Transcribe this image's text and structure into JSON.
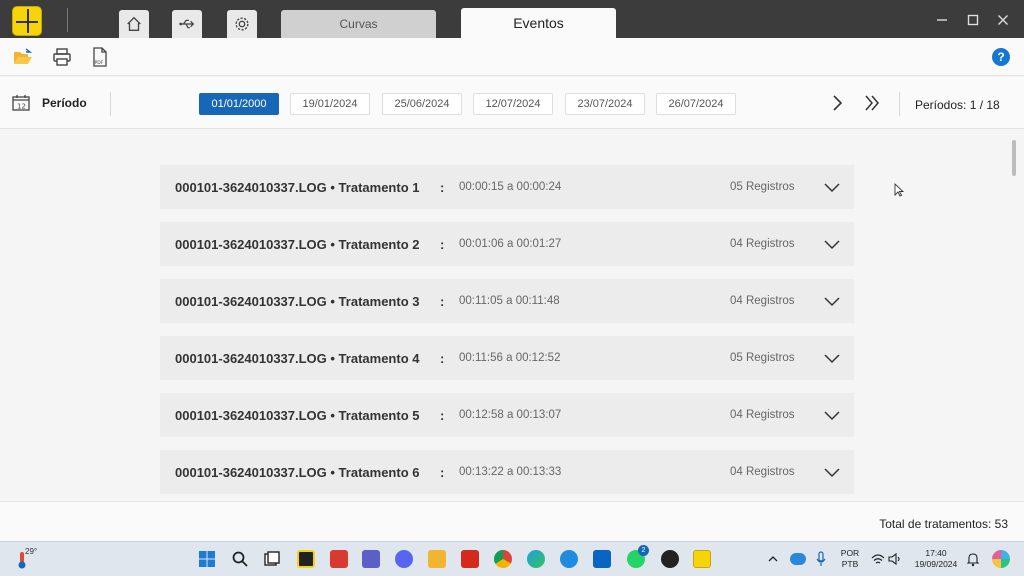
{
  "titlebar": {
    "tabs": [
      {
        "label": "Curvas"
      },
      {
        "label": "Eventos"
      }
    ]
  },
  "period": {
    "label": "Período",
    "dates": [
      "01/01/2000",
      "19/01/2024",
      "25/06/2024",
      "12/07/2024",
      "23/07/2024",
      "26/07/2024"
    ],
    "active_index": 0,
    "count_text": "Períodos: 1 / 18"
  },
  "events": [
    {
      "name": "000101-3624010337.LOG • Tratamento 1",
      "sep": ":",
      "time": "00:00:15 a 00:00:24",
      "count": "05 Registros"
    },
    {
      "name": "000101-3624010337.LOG • Tratamento 2",
      "sep": ":",
      "time": "00:01:06 a 00:01:27",
      "count": "04 Registros"
    },
    {
      "name": "000101-3624010337.LOG • Tratamento 3",
      "sep": ":",
      "time": "00:11:05 a 00:11:48",
      "count": "04 Registros"
    },
    {
      "name": "000101-3624010337.LOG • Tratamento 4",
      "sep": ":",
      "time": "00:11:56 a 00:12:52",
      "count": "05 Registros"
    },
    {
      "name": "000101-3624010337.LOG • Tratamento 5",
      "sep": ":",
      "time": "00:12:58 a 00:13:07",
      "count": "04 Registros"
    },
    {
      "name": "000101-3624010337.LOG • Tratamento 6",
      "sep": ":",
      "time": "00:13:22 a 00:13:33",
      "count": "04 Registros"
    }
  ],
  "footer": {
    "total": "Total de tratamentos: 53"
  },
  "taskbar": {
    "weather_temp": "29°",
    "lang_1": "POR",
    "lang_2": "PTB",
    "time": "17:40",
    "date": "19/09/2024",
    "whatsapp_badge": "2"
  },
  "icons": {
    "home": "home-icon",
    "usb": "usb-icon",
    "settings": "gear-icon",
    "open": "folder-open-icon",
    "print": "printer-icon",
    "pdf": "pdf-icon",
    "help": "help-icon"
  },
  "help_label": "?",
  "colors": {
    "accent": "#1766b8",
    "logo": "#f5d50a",
    "titlebar": "#3c3c3c"
  }
}
